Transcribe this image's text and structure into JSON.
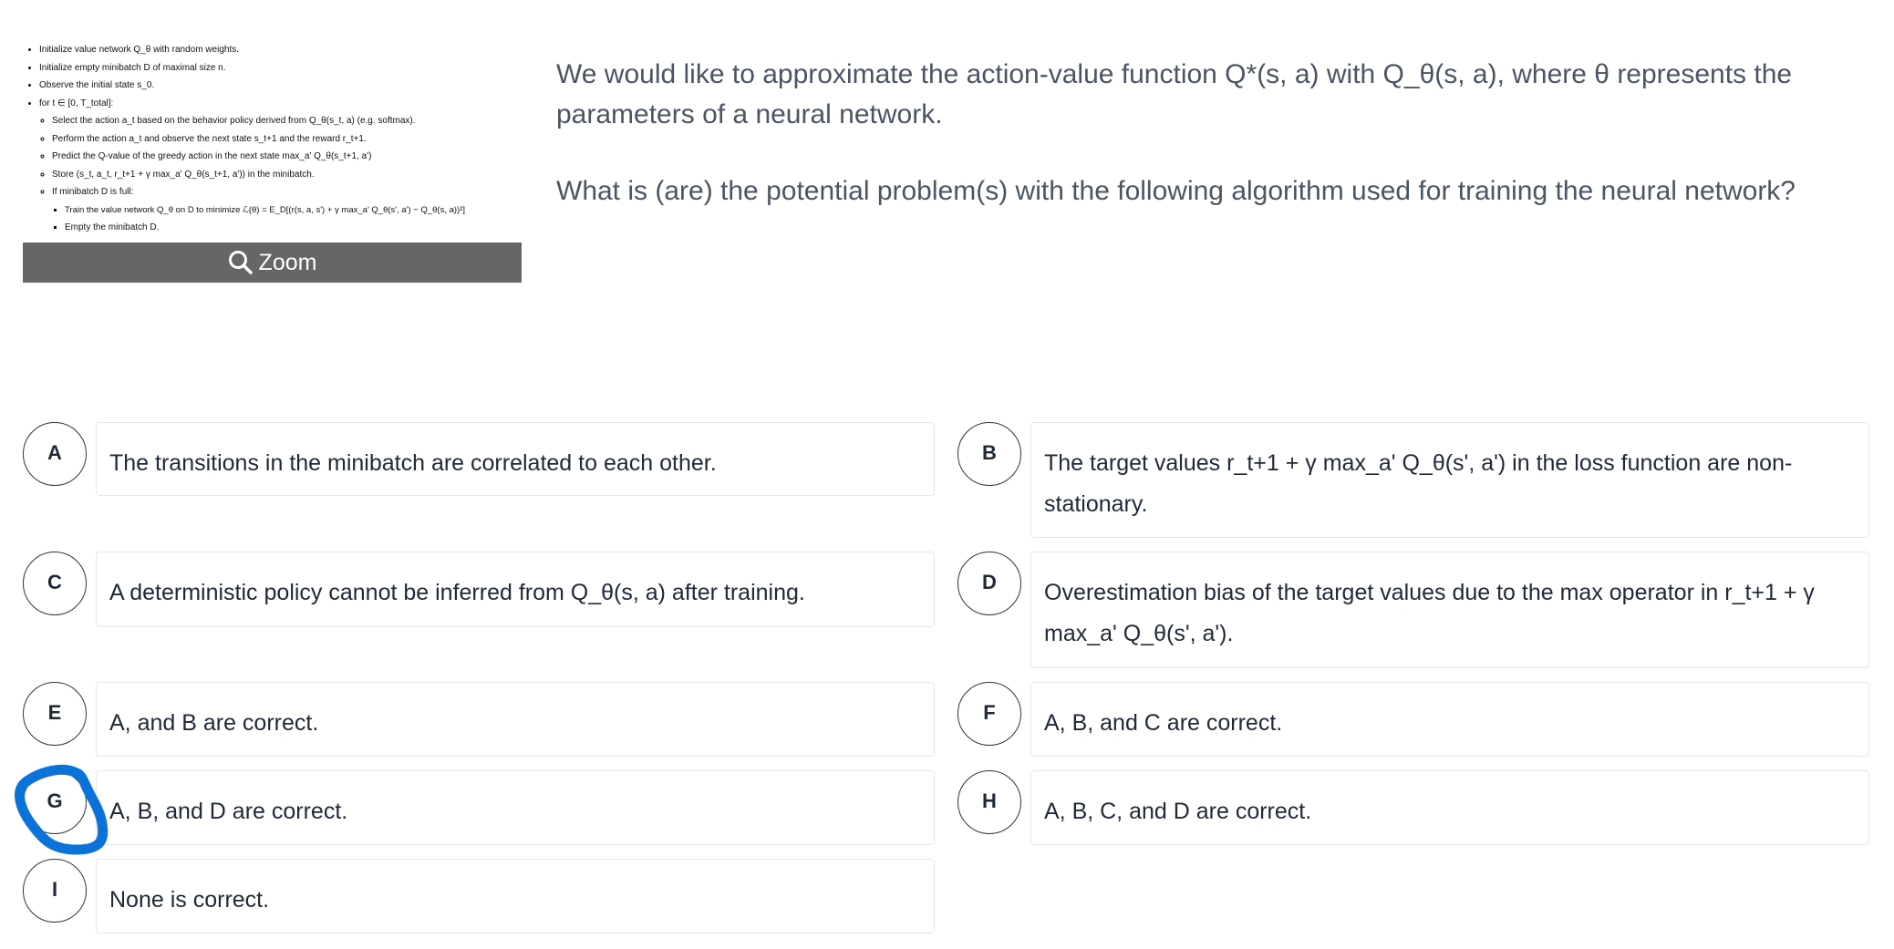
{
  "algorithm": {
    "steps": [
      "Initialize value network Q_θ with random weights.",
      "Initialize empty minibatch D of maximal size n.",
      "Observe the initial state s_0.",
      "for t ∈ [0, T_total]:"
    ],
    "loop_steps": [
      "Select the action a_t based on the behavior policy derived from Q_θ(s_t, a) (e.g. softmax).",
      "Perform the action a_t and observe the next state s_t+1 and the reward r_t+1.",
      "Predict the Q-value of the greedy action in the next state max_a' Q_θ(s_t+1, a')",
      "Store (s_t, a_t, r_t+1 + γ max_a' Q_θ(s_t+1, a')) in the minibatch.",
      "If minibatch D is full:"
    ],
    "inner_steps": [
      "Train the value network Q_θ on D to minimize ℒ(θ) = E_D[(r(s, a, s') + γ max_a' Q_θ(s', a') − Q_θ(s, a))²]",
      "Empty the minibatch D."
    ],
    "zoom_label": "Zoom"
  },
  "question": {
    "intro": "We would like to approximate the action-value function Q*(s, a) with Q_θ(s, a), where θ represents the parameters of a neural network.",
    "prompt": "What is (are) the potential problem(s) with the following algorithm used for training the neural network?"
  },
  "options": [
    {
      "letter": "A",
      "text": "The transitions in the minibatch are correlated to each other."
    },
    {
      "letter": "B",
      "text": "The target values r_t+1 + γ max_a' Q_θ(s', a') in the loss function are non-stationary."
    },
    {
      "letter": "C",
      "text": "A deterministic policy cannot be inferred from Q_θ(s, a) after training."
    },
    {
      "letter": "D",
      "text": "Overestimation bias of the target values due to the max operator in r_t+1 + γ max_a' Q_θ(s', a')."
    },
    {
      "letter": "E",
      "text": "A, and B are correct."
    },
    {
      "letter": "F",
      "text": "A, B, and C are correct."
    },
    {
      "letter": "G",
      "text": "A, B, and D are correct."
    },
    {
      "letter": "H",
      "text": "A, B, C, and D are correct."
    },
    {
      "letter": "I",
      "text": "None is correct."
    }
  ],
  "selected": "G",
  "colors": {
    "mark": "#0a72d8",
    "zoom_bar": "#666666"
  }
}
